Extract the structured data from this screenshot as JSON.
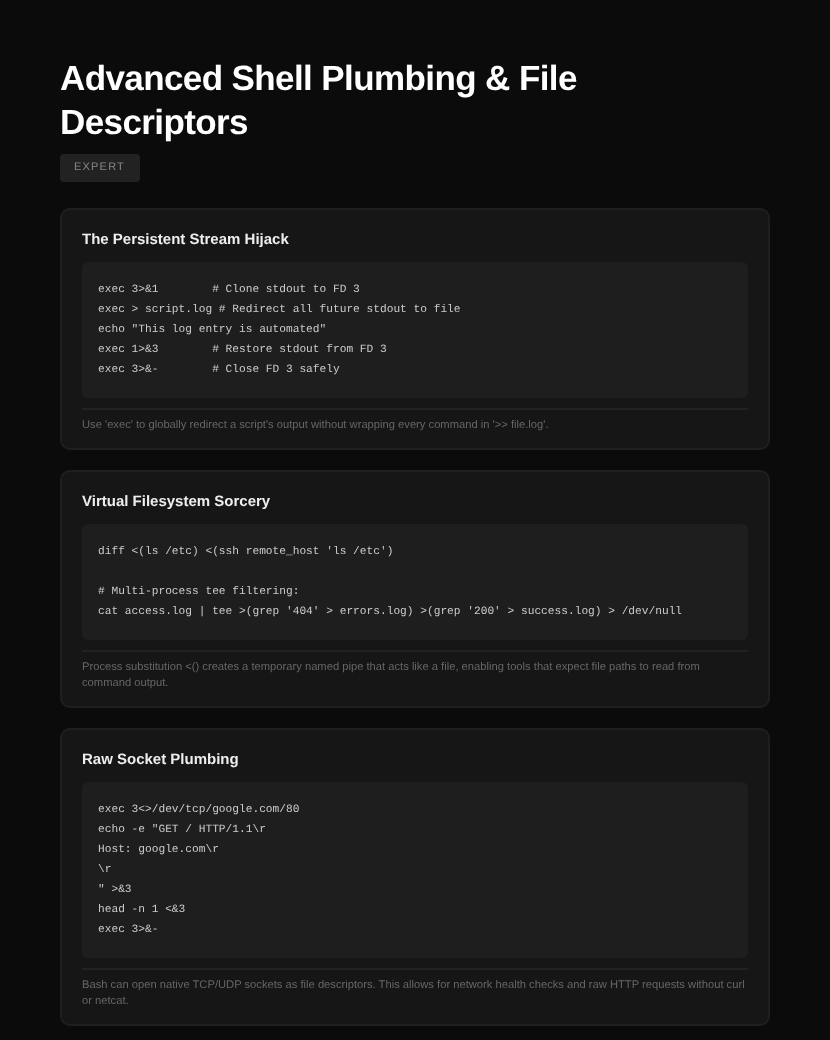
{
  "title": "Advanced Shell Plumbing & File Descriptors",
  "badge": "EXPERT",
  "sections": [
    {
      "heading": "The Persistent Stream Hijack",
      "code": "exec 3>&1        # Clone stdout to FD 3\nexec > script.log # Redirect all future stdout to file\necho \"This log entry is automated\"\nexec 1>&3        # Restore stdout from FD 3\nexec 3>&-        # Close FD 3 safely",
      "note": "Use 'exec' to globally redirect a script's output without wrapping every command in '>> file.log'."
    },
    {
      "heading": "Virtual Filesystem Sorcery",
      "code": "diff <(ls /etc) <(ssh remote_host 'ls /etc')\n\n# Multi-process tee filtering:\ncat access.log | tee >(grep '404' > errors.log) >(grep '200' > success.log) > /dev/null",
      "note": "Process substitution <() creates a temporary named pipe that acts like a file, enabling tools that expect file paths to read from command output."
    },
    {
      "heading": "Raw Socket Plumbing",
      "code": "exec 3<>/dev/tcp/google.com/80\necho -e \"GET / HTTP/1.1\\r\nHost: google.com\\r\n\\r\n\" >&3\nhead -n 1 <&3\nexec 3>&-",
      "note": "Bash can open native TCP/UDP sockets as file descriptors. This allows for network health checks and raw HTTP requests without curl or netcat."
    }
  ]
}
